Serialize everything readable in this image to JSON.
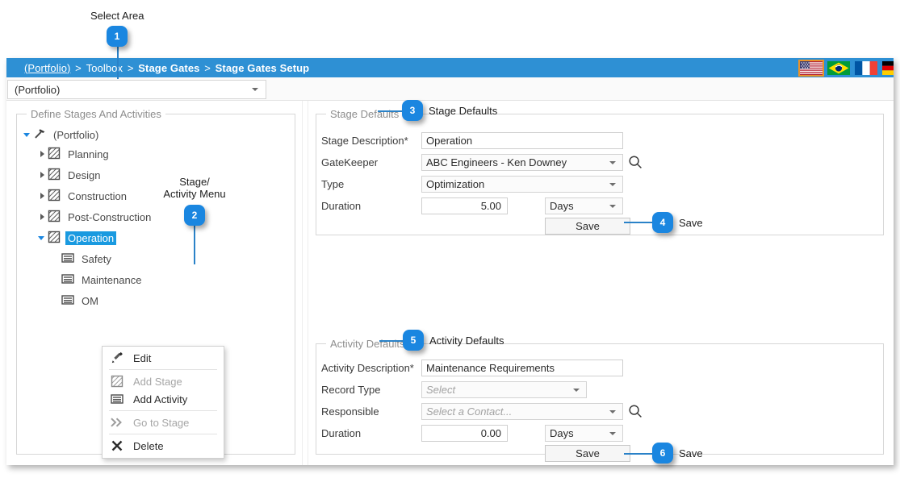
{
  "annotations": [
    {
      "n": "1",
      "label": "Select Area"
    },
    {
      "n": "2",
      "label": "Stage/\nActivity Menu"
    },
    {
      "n": "3",
      "label": "Stage Defaults"
    },
    {
      "n": "4",
      "label": "Save"
    },
    {
      "n": "5",
      "label": "Activity Defaults"
    },
    {
      "n": "6",
      "label": "Save"
    }
  ],
  "titlebar": {
    "breadcrumb": {
      "root": "(Portfolio)",
      "sep1": ">",
      "item1": "Toolbox",
      "sep2": ">",
      "item2": "Stage Gates",
      "sep3": ">",
      "item3": "Stage Gates Setup"
    },
    "flags": [
      {
        "name": "flag-united-states",
        "selected": true
      },
      {
        "name": "flag-brazil",
        "selected": false
      },
      {
        "name": "flag-france",
        "selected": false
      },
      {
        "name": "flag-germany",
        "selected": false
      }
    ]
  },
  "area_selector": {
    "value": "(Portfolio)"
  },
  "left_panel": {
    "title": "Define Stages And Activities",
    "tree": [
      {
        "label": "(Portfolio)",
        "icon": "hammer-icon",
        "indent": 0,
        "twist": "open",
        "selected": false
      },
      {
        "label": "Planning",
        "icon": "stage-icon",
        "indent": 1,
        "twist": "closed",
        "selected": false
      },
      {
        "label": "Design",
        "icon": "stage-icon",
        "indent": 1,
        "twist": "closed",
        "selected": false
      },
      {
        "label": "Construction",
        "icon": "stage-icon",
        "indent": 1,
        "twist": "closed",
        "selected": false
      },
      {
        "label": "Post-Construction",
        "icon": "stage-icon",
        "indent": 1,
        "twist": "closed",
        "selected": false
      },
      {
        "label": "Operation",
        "icon": "stage-icon",
        "indent": 1,
        "twist": "open",
        "selected": true
      },
      {
        "label": "Safety",
        "icon": "activity-icon",
        "indent": 2,
        "twist": "none",
        "selected": false
      },
      {
        "label": "Maintenance",
        "icon": "activity-icon",
        "indent": 2,
        "twist": "none",
        "selected": false
      },
      {
        "label": "OM",
        "icon": "activity-icon",
        "indent": 2,
        "twist": "none",
        "selected": false
      }
    ]
  },
  "context_menu": {
    "items": [
      {
        "label": "Edit",
        "icon": "pencil-icon",
        "disabled": false
      },
      {
        "label": "Add Stage",
        "icon": "stage-icon",
        "disabled": true
      },
      {
        "label": "Add Activity",
        "icon": "activity-icon",
        "disabled": false
      },
      {
        "label": "Go to Stage",
        "icon": "double-chevron-icon",
        "disabled": true
      },
      {
        "label": "Delete",
        "icon": "close-x-icon",
        "disabled": false
      }
    ]
  },
  "stage_defaults": {
    "title": "Stage Defaults",
    "description_label": "Stage Description*",
    "description_value": "Operation",
    "gatekeeper_label": "GateKeeper",
    "gatekeeper_value": "ABC Engineers - Ken Downey",
    "type_label": "Type",
    "type_value": "Optimization",
    "duration_label": "Duration",
    "duration_value": "5.00",
    "duration_unit": "Days",
    "save_label": "Save"
  },
  "activity_defaults": {
    "title": "Activity Defaults",
    "description_label": "Activity Description*",
    "description_value": "Maintenance Requirements",
    "record_type_label": "Record Type",
    "record_type_placeholder": "Select",
    "responsible_label": "Responsible",
    "responsible_placeholder": "Select a Contact...",
    "duration_label": "Duration",
    "duration_value": "0.00",
    "duration_unit": "Days",
    "save_label": "Save"
  },
  "colors": {
    "accent": "#2e90d4",
    "callout": "#1a86e0",
    "selection": "#1a9ae0",
    "flag_selected_outline": "#e8922b"
  }
}
